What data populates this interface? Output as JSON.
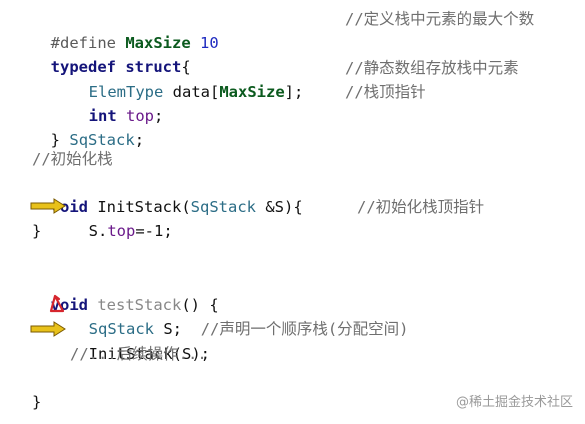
{
  "code": {
    "define": {
      "directive": "#define",
      "macro": "MaxSize",
      "value": "10",
      "comment": "//定义栈中元素的最大个数"
    },
    "typedef_open": {
      "kw_typedef": "typedef",
      "kw_struct": "struct",
      "brace": "{"
    },
    "member_data": {
      "type": "ElemType",
      "name": "data[",
      "macro": "MaxSize",
      "tail": "];",
      "comment": "//静态数组存放栈中元素"
    },
    "member_top": {
      "kw": "int",
      "name": "top",
      "tail": ";",
      "comment": "//栈顶指针"
    },
    "typedef_close": {
      "brace": "}",
      "name": "SqStack",
      "tail": ";"
    },
    "init_comment": "//初始化栈",
    "init_sig": {
      "kw": "void",
      "fn": "InitStack(",
      "type": "SqStack",
      "param": "&S){"
    },
    "init_body": {
      "obj": "S.",
      "field": "top",
      "rest": "=-1;",
      "comment": "//初始化栈顶指针"
    },
    "init_close": "}",
    "test_sig": {
      "kw": "void",
      "fn": "testStack",
      "rest": "() {"
    },
    "test_decl": {
      "type": "SqStack",
      "var": "S;",
      "comment": "//声明一个顺序栈(分配空间)"
    },
    "test_call": {
      "fn": "InitStack(S);"
    },
    "test_more": "//...后续操作...",
    "test_close": "}"
  },
  "annotations": {
    "arrow_color": "#e8c11a",
    "arrow_outline": "#7a5a00",
    "marker_color": "#d6262e",
    "arrow_icon": "arrow-right-icon",
    "marker_icon": "delta-icon"
  },
  "watermark": "@稀土掘金技术社区"
}
